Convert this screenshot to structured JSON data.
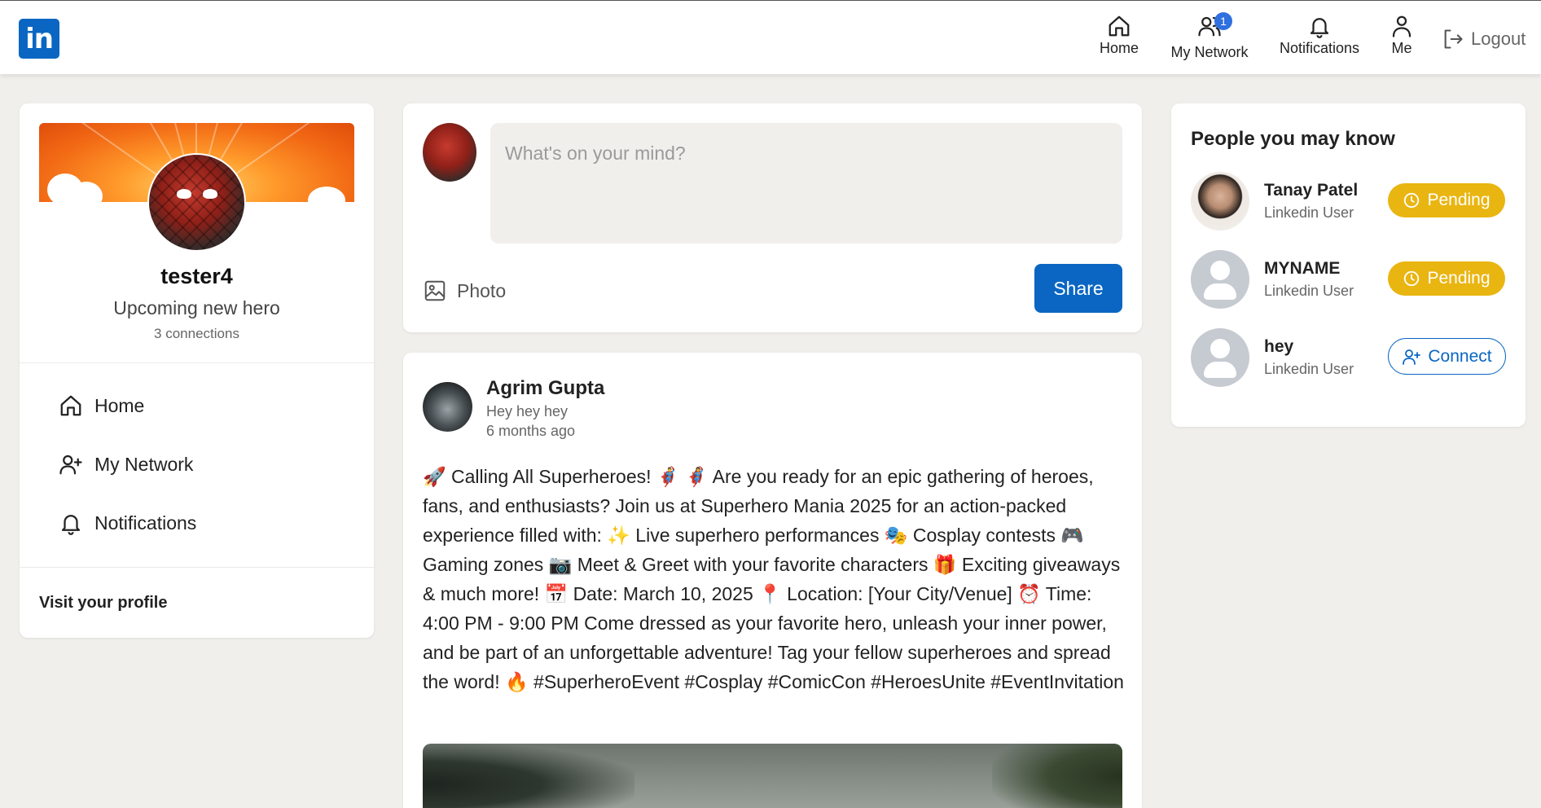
{
  "app": {
    "logo_text": "in",
    "brand_color": "#0a66c2"
  },
  "nav": {
    "items": [
      {
        "label": "Home",
        "icon": "home-icon"
      },
      {
        "label": "My Network",
        "icon": "network-icon",
        "badge": "1"
      },
      {
        "label": "Notifications",
        "icon": "bell-icon"
      },
      {
        "label": "Me",
        "icon": "user-icon"
      }
    ],
    "logout_label": "Logout"
  },
  "profile": {
    "name": "tester4",
    "headline": "Upcoming new hero",
    "connections": "3 connections",
    "links": [
      {
        "label": "Home",
        "icon": "home-icon"
      },
      {
        "label": "My Network",
        "icon": "add-user-icon"
      },
      {
        "label": "Notifications",
        "icon": "bell-icon"
      }
    ],
    "visit_profile": "Visit your profile"
  },
  "composer": {
    "placeholder": "What's on your mind?",
    "value": "",
    "photo_label": "Photo",
    "share_label": "Share"
  },
  "post": {
    "author": "Agrim Gupta",
    "headline": "Hey hey hey",
    "time": "6 months ago",
    "body": "🚀 Calling All Superheroes! 🦸‍♂️ 🦸‍♀️ Are you ready for an epic gathering of heroes, fans, and enthusiasts? Join us at Superhero Mania 2025 for an action-packed experience filled with: ✨ Live superhero performances 🎭 Cosplay contests 🎮 Gaming zones 📷 Meet & Greet with your favorite characters 🎁 Exciting giveaways & much more! 📅 Date: March 10, 2025 📍 Location: [Your City/Venue] ⏰ Time: 4:00 PM - 9:00 PM Come dressed as your favorite hero, unleash your inner power, and be part of an unforgettable adventure! Tag your fellow superheroes and spread the word! 🔥 #SuperheroEvent #Cosplay #ComicCon #HeroesUnite #EventInvitation"
  },
  "people": {
    "title": "People you may know",
    "list": [
      {
        "name": "Tanay Patel",
        "subtitle": "Linkedin User",
        "action": "Pending"
      },
      {
        "name": "MYNAME",
        "subtitle": "Linkedin User",
        "action": "Pending"
      },
      {
        "name": "hey",
        "subtitle": "Linkedin User",
        "action": "Connect"
      }
    ],
    "pending_color": "#e9b511"
  }
}
